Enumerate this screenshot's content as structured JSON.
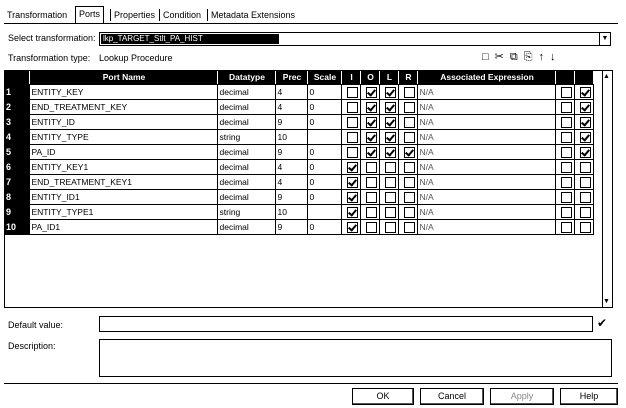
{
  "tabs": [
    {
      "label": "Transformation"
    },
    {
      "label": "Ports"
    },
    {
      "label": "Properties"
    },
    {
      "label": "Condition"
    },
    {
      "label": "Metadata Extensions"
    }
  ],
  "select_transformation": {
    "label": "Select transformation:",
    "value": "lkp_TARGET_Stlt_PA_HIST"
  },
  "transformation_type": {
    "label": "Transformation type:",
    "value": "Lookup Procedure"
  },
  "toolbar": {
    "icons": [
      "new-port-icon",
      "cut-icon",
      "copy-icon",
      "paste-icon",
      "move-up-icon",
      "move-down-icon"
    ],
    "glyphs": [
      "□",
      "✂",
      "⧉",
      "⎘",
      "↑",
      "↓"
    ]
  },
  "grid": {
    "columns": [
      "Port Name",
      "Datatype",
      "Prec",
      "Scale",
      "I",
      "O",
      "L",
      "R",
      "Associated Expression",
      "",
      ""
    ],
    "rows": [
      {
        "num": "1",
        "name": "ENTITY_KEY",
        "datatype": "decimal",
        "prec": "4",
        "scale": "0",
        "i": false,
        "o": true,
        "l": true,
        "r": false,
        "expr": "N/A",
        "e1": false,
        "e2": true
      },
      {
        "num": "2",
        "name": "END_TREATMENT_KEY",
        "datatype": "decimal",
        "prec": "4",
        "scale": "0",
        "i": false,
        "o": true,
        "l": true,
        "r": false,
        "expr": "N/A",
        "e1": false,
        "e2": true
      },
      {
        "num": "3",
        "name": "ENTITY_ID",
        "datatype": "decimal",
        "prec": "9",
        "scale": "0",
        "i": false,
        "o": true,
        "l": true,
        "r": false,
        "expr": "N/A",
        "e1": false,
        "e2": true
      },
      {
        "num": "4",
        "name": "ENTITY_TYPE",
        "datatype": "string",
        "prec": "10",
        "scale": "",
        "i": false,
        "o": true,
        "l": true,
        "r": false,
        "expr": "N/A",
        "e1": false,
        "e2": true
      },
      {
        "num": "5",
        "name": "PA_ID",
        "datatype": "decimal",
        "prec": "9",
        "scale": "0",
        "i": false,
        "o": true,
        "l": true,
        "r": true,
        "expr": "N/A",
        "e1": false,
        "e2": true
      },
      {
        "num": "6",
        "name": "ENTITY_KEY1",
        "datatype": "decimal",
        "prec": "4",
        "scale": "0",
        "i": true,
        "o": false,
        "l": false,
        "r": false,
        "expr": "N/A",
        "e1": false,
        "e2": false
      },
      {
        "num": "7",
        "name": "END_TREATMENT_KEY1",
        "datatype": "decimal",
        "prec": "4",
        "scale": "0",
        "i": true,
        "o": false,
        "l": false,
        "r": false,
        "expr": "N/A",
        "e1": false,
        "e2": false
      },
      {
        "num": "8",
        "name": "ENTITY_ID1",
        "datatype": "decimal",
        "prec": "9",
        "scale": "0",
        "i": true,
        "o": false,
        "l": false,
        "r": false,
        "expr": "N/A",
        "e1": false,
        "e2": false
      },
      {
        "num": "9",
        "name": "ENTITY_TYPE1",
        "datatype": "string",
        "prec": "10",
        "scale": "",
        "i": true,
        "o": false,
        "l": false,
        "r": false,
        "expr": "N/A",
        "e1": false,
        "e2": false
      },
      {
        "num": "10",
        "name": "PA_ID1",
        "datatype": "decimal",
        "prec": "9",
        "scale": "0",
        "i": true,
        "o": false,
        "l": false,
        "r": false,
        "expr": "N/A",
        "e1": false,
        "e2": false
      }
    ]
  },
  "default_value": {
    "label": "Default value:",
    "value": ""
  },
  "description": {
    "label": "Description:",
    "value": ""
  },
  "buttons": {
    "ok": "OK",
    "cancel": "Cancel",
    "apply": "Apply",
    "help": "Help"
  }
}
